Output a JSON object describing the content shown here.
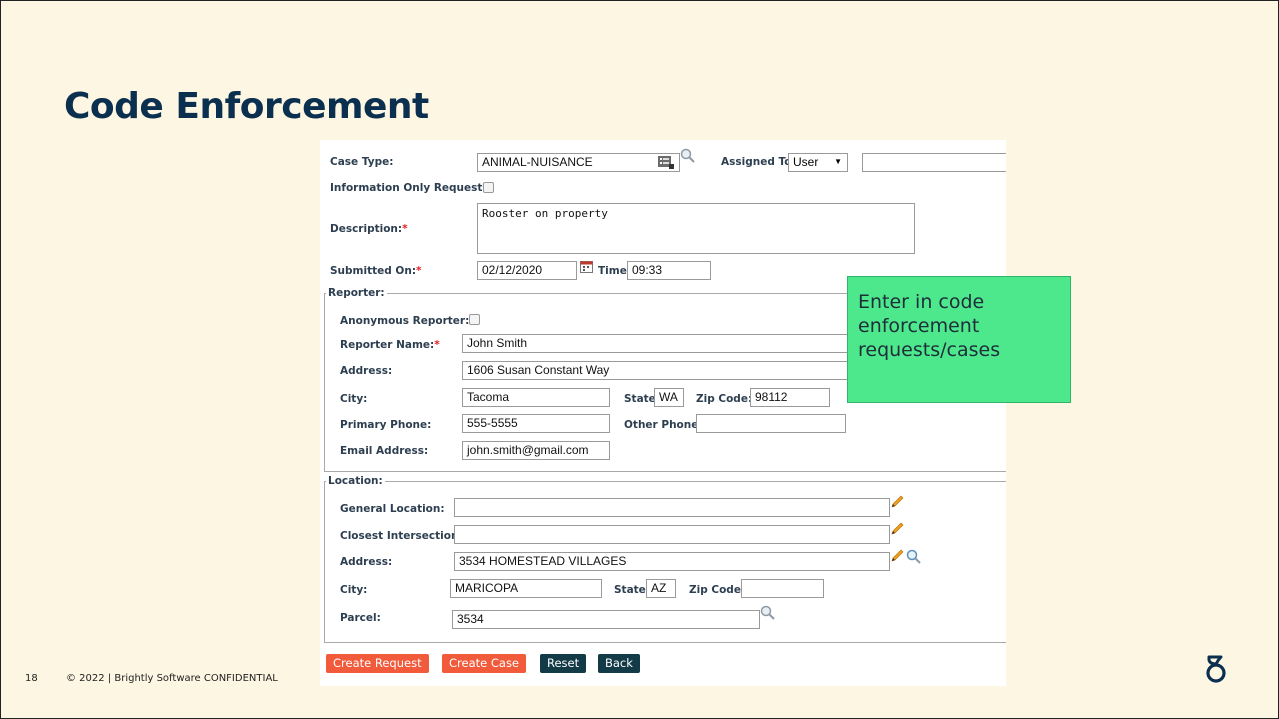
{
  "slide": {
    "title": "Code Enforcement",
    "page_number": "18",
    "copyright": "© 2022 | Brightly Software CONFIDENTIAL"
  },
  "callout": {
    "text": "Enter in code enforcement requests/cases",
    "color": "#4ee88c"
  },
  "form": {
    "case_type": {
      "label": "Case Type:",
      "value": "ANIMAL-NUISANCE"
    },
    "assigned_to": {
      "label": "Assigned To:",
      "selected": "User",
      "value": ""
    },
    "info_only": {
      "label": "Information Only Request:",
      "checked": false
    },
    "description": {
      "label": "Description:",
      "required_mark": "*",
      "value": "Rooster on property"
    },
    "submitted_on": {
      "label": "Submitted On:",
      "required_mark": "*",
      "value": "02/12/2020"
    },
    "time": {
      "label": "Time:",
      "value": "09:33"
    },
    "reporter": {
      "legend": "Reporter:",
      "anonymous": {
        "label": "Anonymous Reporter:",
        "checked": false
      },
      "name": {
        "label": "Reporter Name:",
        "required_mark": "*",
        "value": "John Smith"
      },
      "address": {
        "label": "Address:",
        "value": "1606 Susan Constant Way"
      },
      "city": {
        "label": "City:",
        "value": "Tacoma"
      },
      "state": {
        "label": "State:",
        "value": "WA"
      },
      "zip": {
        "label": "Zip Code:",
        "value": "98112"
      },
      "primary_phone": {
        "label": "Primary Phone:",
        "value": "555-5555"
      },
      "other_phone": {
        "label": "Other Phone:",
        "value": ""
      },
      "email": {
        "label": "Email Address:",
        "value": "john.smith@gmail.com"
      }
    },
    "location": {
      "legend": "Location:",
      "general": {
        "label": "General Location:",
        "value": ""
      },
      "intersection": {
        "label": "Closest Intersection:",
        "value": ""
      },
      "address": {
        "label": "Address:",
        "value": "3534 HOMESTEAD VILLAGES"
      },
      "city": {
        "label": "City:",
        "value": "MARICOPA"
      },
      "state": {
        "label": "State:",
        "value": "AZ"
      },
      "zip": {
        "label": "Zip Code:",
        "value": ""
      },
      "parcel": {
        "label": "Parcel:",
        "value": "3534"
      }
    },
    "buttons": {
      "create_request": "Create Request",
      "create_case": "Create Case",
      "reset": "Reset",
      "back": "Back"
    }
  },
  "colors": {
    "background": "#fdf6e3",
    "title": "#0b2f4f",
    "button_orange": "#f15a3b",
    "button_dark": "#123a47"
  },
  "icons": [
    "lookup-list-icon",
    "magnifier-icon",
    "calendar-icon",
    "pencil-icon",
    "brightly-logo-icon"
  ]
}
